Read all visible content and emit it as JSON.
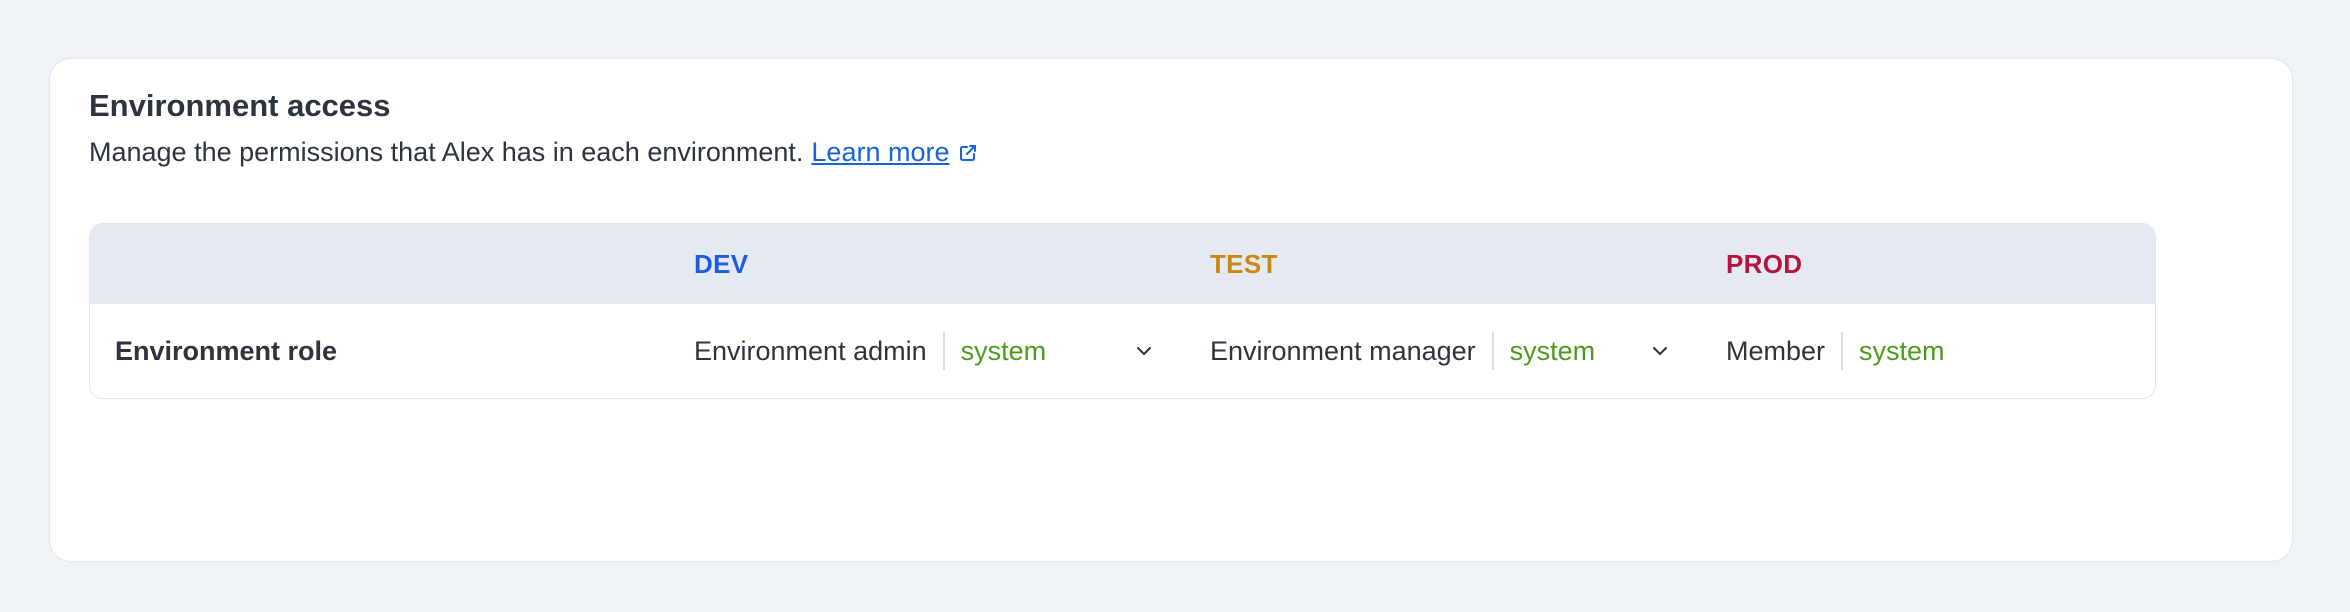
{
  "section": {
    "title": "Environment access",
    "description": "Manage the permissions that Alex has in each environment.",
    "learn_more_label": "Learn more",
    "link_icon": "external-link-icon"
  },
  "table": {
    "row_label": "Environment role",
    "columns": [
      {
        "name": "DEV",
        "color": "#1f5ce0",
        "role": "Environment admin",
        "source": "system"
      },
      {
        "name": "TEST",
        "color": "#c48a12",
        "role": "Environment manager",
        "source": "system"
      },
      {
        "name": "PROD",
        "color": "#b3153e",
        "role": "Member",
        "source": "system"
      }
    ],
    "chevron_icon": "chevron-down-icon"
  }
}
